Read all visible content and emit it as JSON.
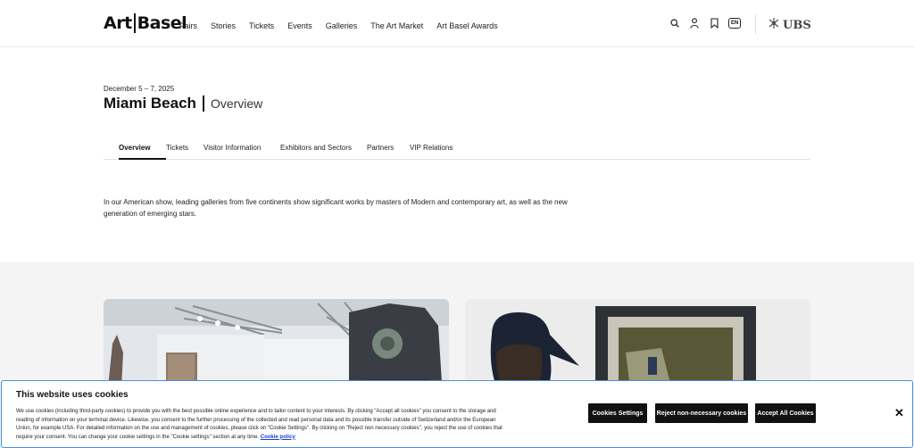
{
  "header": {
    "logo_left": "Art",
    "logo_right": "Basel",
    "nav": [
      "Fairs",
      "Stories",
      "Tickets",
      "Events",
      "Galleries",
      "The Art Market",
      "Art Basel Awards"
    ],
    "lang": "EN",
    "sponsor": "UBS"
  },
  "page": {
    "date": "December 5 – 7, 2025",
    "title": "Miami Beach",
    "subtitle": "Overview",
    "tabs": [
      "Overview",
      "Tickets",
      "Visitor Information",
      "Exhibitors and Sectors",
      "Partners",
      "VIP Relations"
    ],
    "intro": "In our American show, leading galleries from five continents show significant works by masters of Modern and contemporary art, as well as the new generation of emerging stars."
  },
  "cookies": {
    "title": "This website uses cookies",
    "text": "We use cookies (including third-party cookies) to provide you with the best possible online experience and to tailor content to your interests. By clicking \"Accept all cookies\" you consent to the storage and reading of information on your terminal device. Likewise, you consent to the further processing of the collected and read personal data and its possible transfer outside of Switzerland and/or the European Union, for example USA. For detailed information on the use and management of cookies, please click on \"Cookie Settings\". By clicking on \"Reject non necessary cookies\", you reject the use of cookies that require your consent. You can change your cookie settings in the \"Cookie settings\" section at any time.",
    "policy_link": "Cookie policy",
    "settings_btn": "Cookies Settings",
    "reject_btn": "Reject non-necessary cookies",
    "accept_btn": "Accept All Cookies",
    "close": "✕"
  },
  "icons": {
    "search": "search-icon",
    "user": "user-icon",
    "bookmark": "bookmark-icon",
    "ubs_keys": "ubs-keys-icon"
  }
}
